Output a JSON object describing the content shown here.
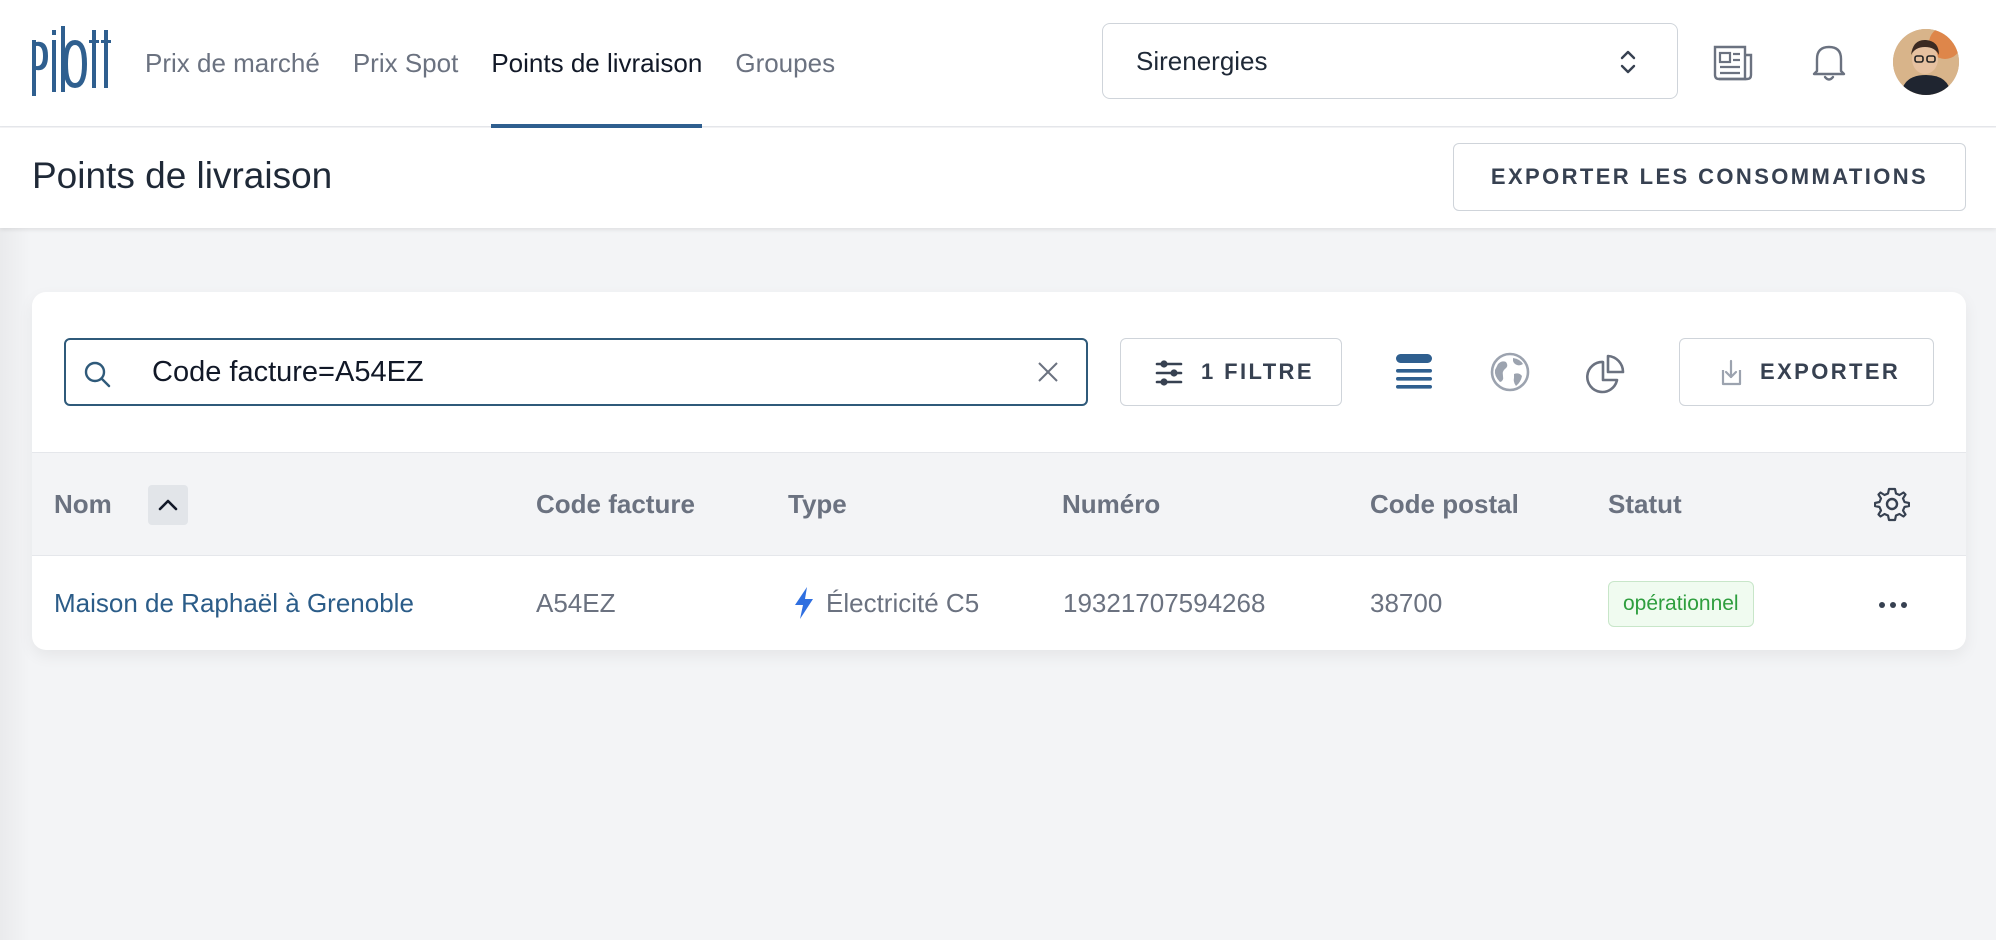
{
  "brand": {
    "logo_text": "pilott",
    "color": "#2f5f8f"
  },
  "nav": {
    "items": [
      {
        "label": "Prix de marché",
        "active": false
      },
      {
        "label": "Prix Spot",
        "active": false
      },
      {
        "label": "Points de livraison",
        "active": true
      },
      {
        "label": "Groupes",
        "active": false
      }
    ]
  },
  "org_select": {
    "value": "Sirenergies"
  },
  "header_icons": [
    "newspaper-icon",
    "bell-icon",
    "avatar"
  ],
  "page": {
    "title": "Points de livraison",
    "export_consumptions_label": "EXPORTER LES CONSOMMATIONS"
  },
  "toolbar": {
    "search_value": "Code facture=A54EZ",
    "filter_label": "1 FILTRE",
    "view_icons": [
      "list-view-icon",
      "globe-icon",
      "pie-chart-icon"
    ],
    "export_label": "EXPORTER"
  },
  "table": {
    "columns": {
      "name": "Nom",
      "invoice_code": "Code facture",
      "type": "Type",
      "number": "Numéro",
      "postal_code": "Code postal",
      "status": "Statut"
    },
    "rows": [
      {
        "name": "Maison de Raphaël à Grenoble",
        "invoice_code": "A54EZ",
        "type": "Électricité C5",
        "number": "19321707594268",
        "postal_code": "38700",
        "status": "opérationnel"
      }
    ]
  },
  "colors": {
    "accent": "#2f5f8f",
    "link": "#2b5c88",
    "lightning": "#2f6fe0",
    "status_green": "#2e9e3e"
  }
}
